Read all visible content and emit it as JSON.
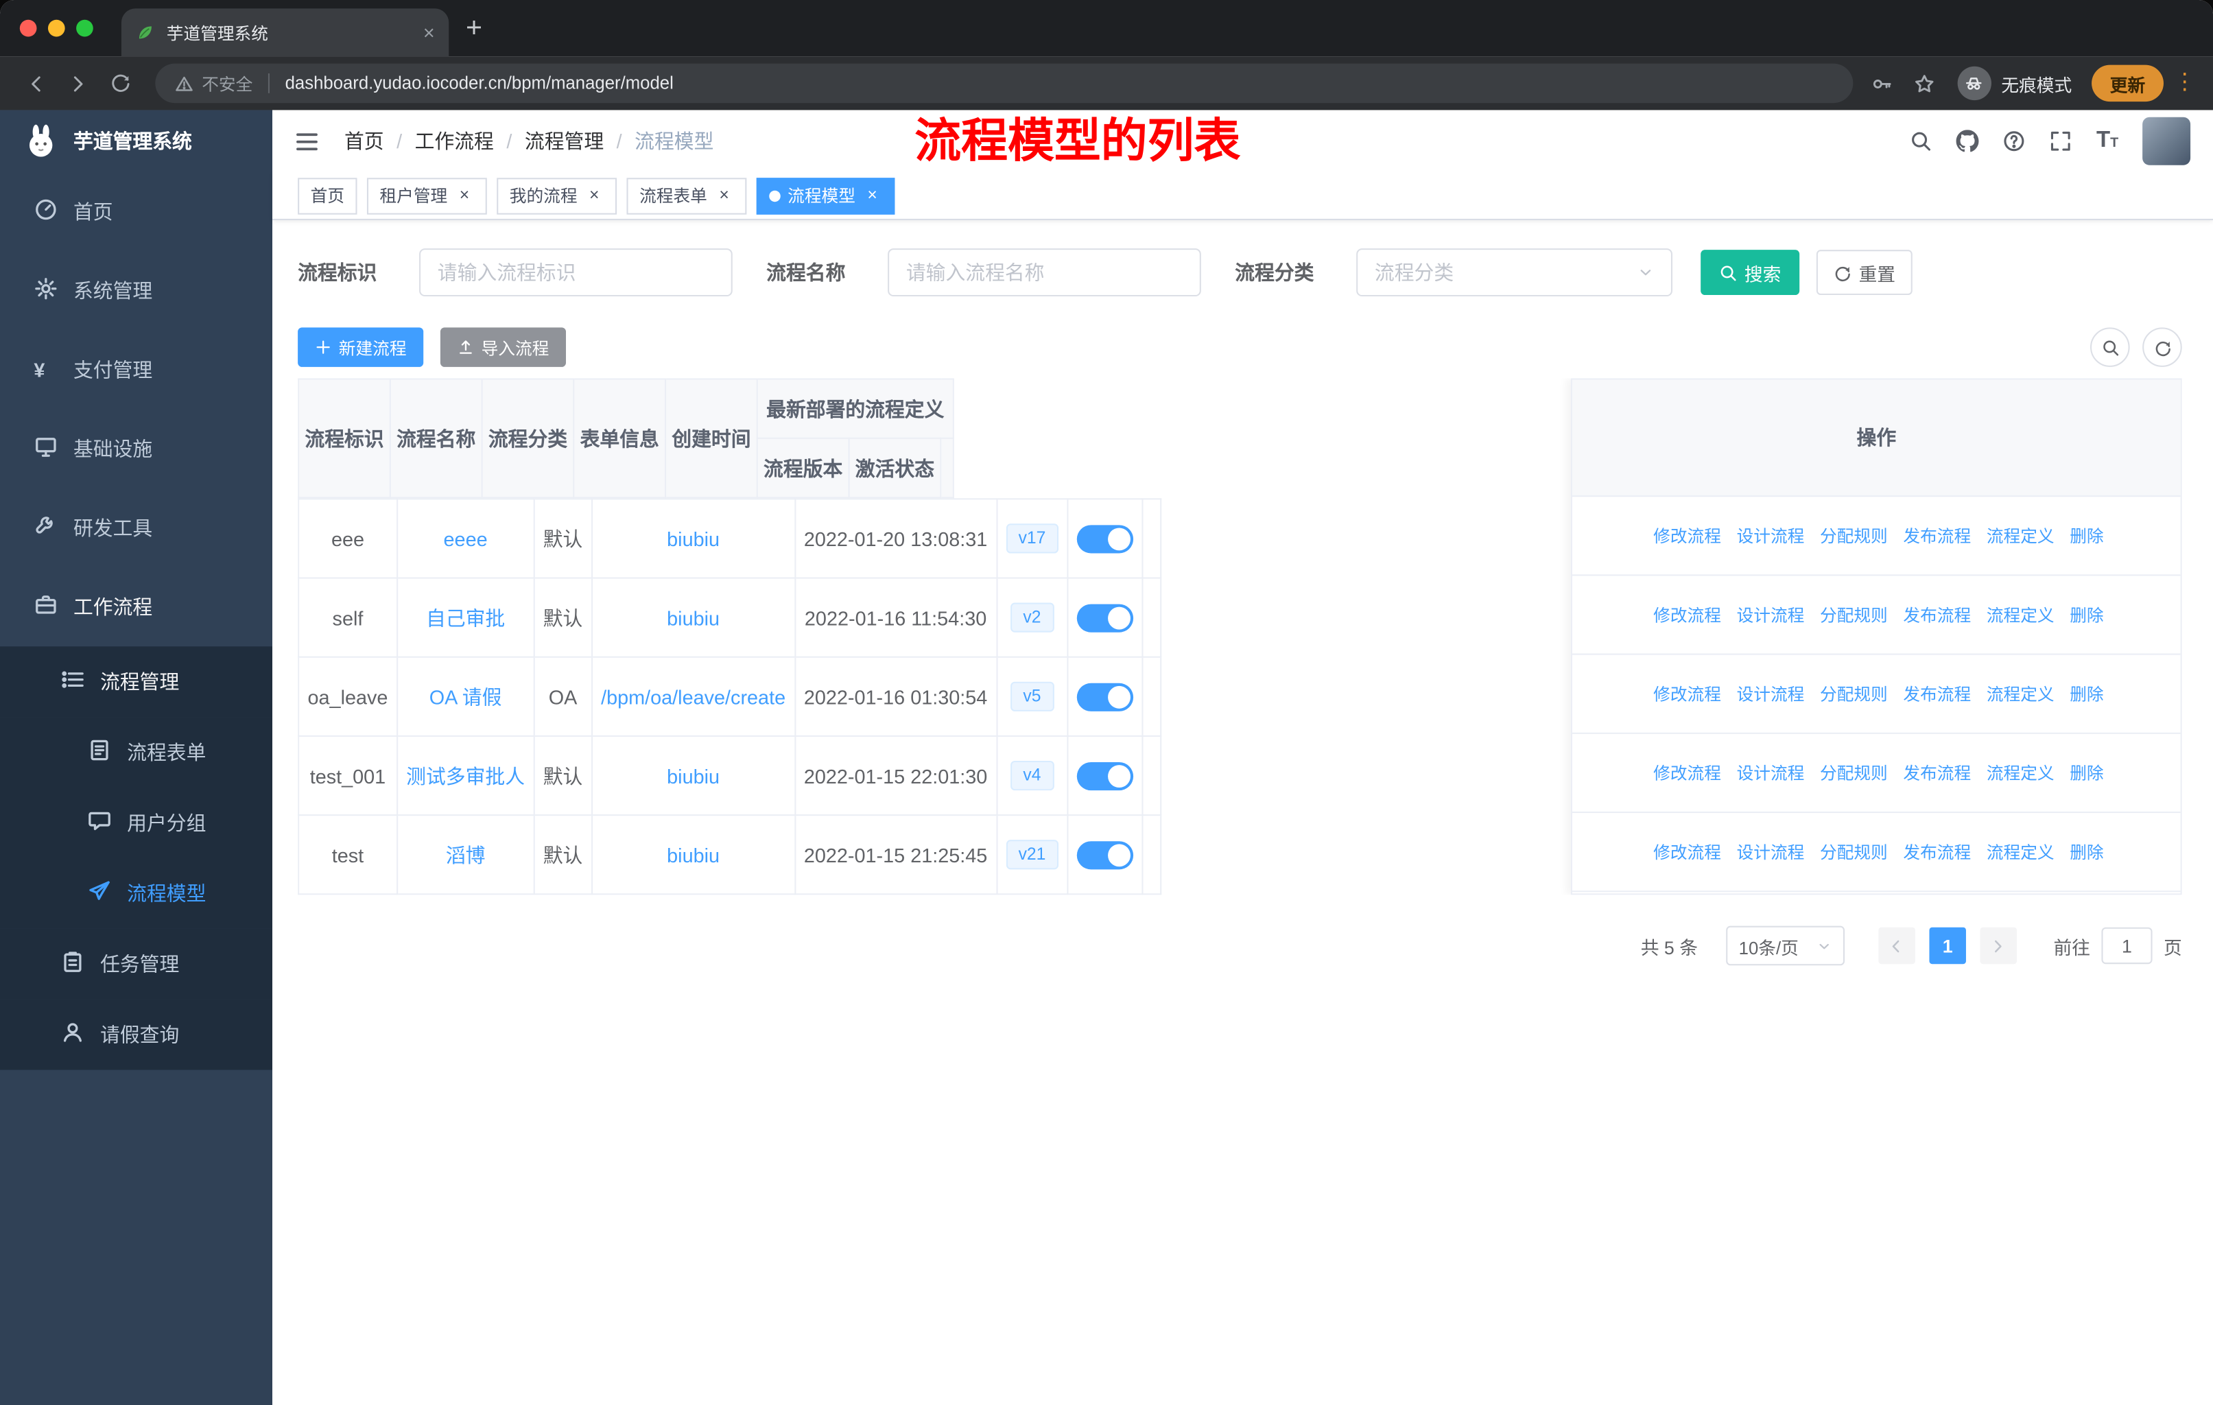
{
  "colors": {
    "accent": "#409EFF",
    "search_button": "#18BC9C",
    "sidebar_bg": "#304156",
    "submenu_bg": "#1F2D3D",
    "annotation_red": "#FF0000",
    "active_tag": "#409EFF"
  },
  "browser": {
    "tab_title": "芋道管理系统",
    "security_label": "不安全",
    "url": "dashboard.yudao.iocoder.cn/bpm/manager/model",
    "incognito_label": "无痕模式",
    "update_label": "更新"
  },
  "sidebar": {
    "app_title": "芋道管理系统",
    "items": [
      {
        "id": "home",
        "label": "首页",
        "icon": "dashboard-icon",
        "level": 1
      },
      {
        "id": "system-management",
        "label": "系统管理",
        "icon": "gear-icon",
        "level": 1,
        "arrow": "down"
      },
      {
        "id": "payment-management",
        "label": "支付管理",
        "icon": "yen-icon",
        "level": 1,
        "arrow": "down"
      },
      {
        "id": "infrastructure",
        "label": "基础设施",
        "icon": "infra-icon",
        "level": 1,
        "arrow": "down"
      },
      {
        "id": "dev-tools",
        "label": "研发工具",
        "icon": "tool-icon",
        "level": 1,
        "arrow": "down"
      },
      {
        "id": "workflow",
        "label": "工作流程",
        "icon": "briefcase-icon",
        "level": 1,
        "arrow": "up",
        "highlight": true
      },
      {
        "id": "process-management",
        "label": "流程管理",
        "icon": "list-icon",
        "level": 2,
        "arrow": "up",
        "highlight": true
      },
      {
        "id": "process-form",
        "label": "流程表单",
        "icon": "document-icon",
        "level": 3
      },
      {
        "id": "user-group",
        "label": "用户分组",
        "icon": "chat-icon",
        "level": 3
      },
      {
        "id": "process-model",
        "label": "流程模型",
        "icon": "paper-plane-icon",
        "level": 3,
        "active": true
      },
      {
        "id": "task-management",
        "label": "任务管理",
        "icon": "clipboard-icon",
        "level": 2,
        "arrow": "down"
      },
      {
        "id": "leave-query",
        "label": "请假查询",
        "icon": "user-icon",
        "level": 2
      }
    ]
  },
  "header": {
    "breadcrumb": [
      "首页",
      "工作流程",
      "流程管理",
      "流程模型"
    ],
    "annotation": "流程模型的列表"
  },
  "tags": [
    {
      "id": "home",
      "label": "首页",
      "closable": false,
      "active": false
    },
    {
      "id": "tenant-management",
      "label": "租户管理",
      "closable": true,
      "active": false
    },
    {
      "id": "my-process",
      "label": "我的流程",
      "closable": true,
      "active": false
    },
    {
      "id": "process-form",
      "label": "流程表单",
      "closable": true,
      "active": false
    },
    {
      "id": "process-model",
      "label": "流程模型",
      "closable": true,
      "active": true
    }
  ],
  "filters": {
    "key_label": "流程标识",
    "key_placeholder": "请输入流程标识",
    "name_label": "流程名称",
    "name_placeholder": "请输入流程名称",
    "category_label": "流程分类",
    "category_placeholder": "流程分类",
    "search_label": "搜索",
    "reset_label": "重置"
  },
  "toolbar": {
    "create_label": "新建流程",
    "import_label": "导入流程"
  },
  "table": {
    "headers": {
      "key": "流程标识",
      "name": "流程名称",
      "category": "流程分类",
      "form": "表单信息",
      "created": "创建时间",
      "deploy_group": "最新部署的流程定义",
      "version": "流程版本",
      "active": "激活状态",
      "actions": "操作"
    },
    "actions": [
      {
        "name": "edit-process-link",
        "icon": "edit-icon",
        "label": "修改流程"
      },
      {
        "name": "design-process-link",
        "icon": "design-icon",
        "label": "设计流程"
      },
      {
        "name": "assign-rule-link",
        "icon": "assign-user-icon",
        "label": "分配规则"
      },
      {
        "name": "publish-process-link",
        "icon": "publish-icon",
        "label": "发布流程"
      },
      {
        "name": "process-definition-link",
        "icon": "link-icon",
        "label": "流程定义"
      },
      {
        "name": "delete-link",
        "icon": "trash-icon",
        "label": "删除"
      }
    ],
    "rows": [
      {
        "key": "eee",
        "name": "eeee",
        "category": "默认",
        "form": "biubiu",
        "created": "2022-01-20 13:08:31",
        "version": "v17",
        "active": true
      },
      {
        "key": "self",
        "name": "自己审批",
        "category": "默认",
        "form": "biubiu",
        "created": "2022-01-16 11:54:30",
        "version": "v2",
        "active": true
      },
      {
        "key": "oa_leave",
        "name": "OA 请假",
        "category": "OA",
        "form": "/bpm/oa/leave/create",
        "created": "2022-01-16 01:30:54",
        "version": "v5",
        "active": true
      },
      {
        "key": "test_001",
        "name": "测试多审批人",
        "category": "默认",
        "form": "biubiu",
        "created": "2022-01-15 22:01:30",
        "version": "v4",
        "active": true
      },
      {
        "key": "test",
        "name": "滔博",
        "category": "默认",
        "form": "biubiu",
        "created": "2022-01-15 21:25:45",
        "version": "v21",
        "active": true
      }
    ]
  },
  "pagination": {
    "total": "共 5 条",
    "page_size": "10条/页",
    "current_page": "1",
    "goto_label": "前往",
    "goto_value": "1",
    "page_unit": "页"
  }
}
